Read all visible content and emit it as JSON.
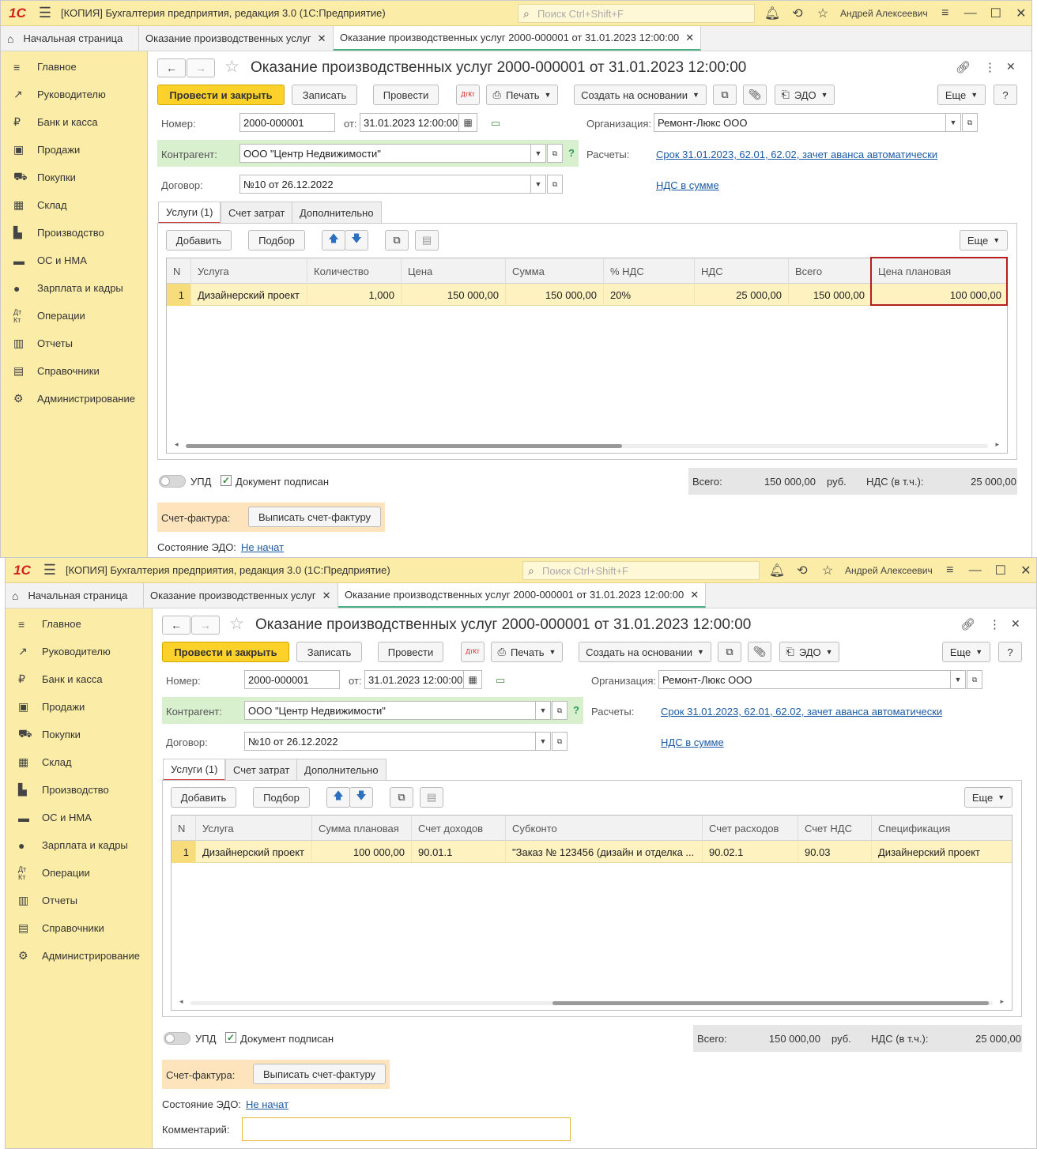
{
  "app": {
    "logo": "1С",
    "title": "[КОПИЯ] Бухгалтерия предприятия, редакция 3.0  (1С:Предприятие)",
    "search_placeholder": "Поиск Ctrl+Shift+F",
    "user": "Андрей Алексеевич"
  },
  "tabs": {
    "home": "Начальная страница",
    "tab2": "Оказание производственных услуг",
    "tab3": "Оказание производственных услуг 2000-000001 от 31.01.2023 12:00:00"
  },
  "sidebar": {
    "items": [
      {
        "label": "Главное",
        "icon": "menu-icon"
      },
      {
        "label": "Руководителю",
        "icon": "trend-icon"
      },
      {
        "label": "Банк и касса",
        "icon": "coin-icon"
      },
      {
        "label": "Продажи",
        "icon": "bag-icon"
      },
      {
        "label": "Покупки",
        "icon": "cart-icon"
      },
      {
        "label": "Склад",
        "icon": "grid-icon"
      },
      {
        "label": "Производство",
        "icon": "factory-icon"
      },
      {
        "label": "ОС и НМА",
        "icon": "truck-icon"
      },
      {
        "label": "Зарплата и кадры",
        "icon": "person-icon"
      },
      {
        "label": "Операции",
        "icon": "dt-kt-icon"
      },
      {
        "label": "Отчеты",
        "icon": "bar-chart-icon"
      },
      {
        "label": "Справочники",
        "icon": "books-icon"
      },
      {
        "label": "Администрирование",
        "icon": "gear-icon"
      }
    ]
  },
  "doc": {
    "title": "Оказание производственных услуг 2000-000001 от 31.01.2023 12:00:00",
    "toolbar": {
      "post_close": "Провести и закрыть",
      "save": "Записать",
      "post": "Провести",
      "dtkt": "ДтКт",
      "print": "Печать",
      "create_based": "Создать на основании",
      "edo": "ЭДО",
      "more": "Еще",
      "help": "?"
    },
    "number_label": "Номер:",
    "number": "2000-000001",
    "date_label": "от:",
    "date": "31.01.2023 12:00:00",
    "org_label": "Организация:",
    "org": "Ремонт-Люкс ООО",
    "contractor_label": "Контрагент:",
    "contractor": "ООО \"Центр Недвижимости\"",
    "settlements_label": "Расчеты:",
    "settlements_link": "Срок 31.01.2023, 62.01, 62.02, зачет аванса автоматически",
    "contract_label": "Договор:",
    "contract": "№10 от 26.12.2022",
    "vat_link": "НДС в сумме",
    "doc_tabs": [
      "Услуги (1)",
      "Счет затрат",
      "Дополнительно"
    ],
    "table_toolbar": {
      "add": "Добавить",
      "pick": "Подбор",
      "more": "Еще"
    },
    "upd_label": "УПД",
    "signed_label": "Документ подписан",
    "total_label": "Всего:",
    "total": "150 000,00",
    "currency": "руб.",
    "vat_total_label": "НДС (в т.ч.):",
    "vat_total": "25 000,00",
    "invoice_label": "Счет-фактура:",
    "invoice_button": "Выписать счет-фактуру",
    "edo_state_label": "Состояние ЭДО:",
    "edo_state": "Не начат",
    "comment_label": "Комментарий:",
    "comment": ""
  },
  "table1": {
    "headers": [
      "N",
      "Услуга",
      "Количество",
      "Цена",
      "Сумма",
      "% НДС",
      "НДС",
      "Всего",
      "Цена плановая"
    ],
    "row": [
      "1",
      "Дизайнерский проект",
      "1,000",
      "150 000,00",
      "150 000,00",
      "20%",
      "25 000,00",
      "150 000,00",
      "100 000,00"
    ]
  },
  "table2": {
    "headers": [
      "N",
      "Услуга",
      "Сумма плановая",
      "Счет доходов",
      "Субконто",
      "Счет расходов",
      "Счет НДС",
      "Спецификация"
    ],
    "row": [
      "1",
      "Дизайнерский проект",
      "100 000,00",
      "90.01.1",
      "\"Заказ № 123456 (дизайн и отделка ...",
      "90.02.1",
      "90.03",
      "Дизайнерский проект"
    ]
  },
  "colors": {
    "accent_yellow": "#fcd12a",
    "panel_yellow": "#fbeca7",
    "highlight_red": "#b41e1e",
    "link_blue": "#1c5aa3"
  }
}
